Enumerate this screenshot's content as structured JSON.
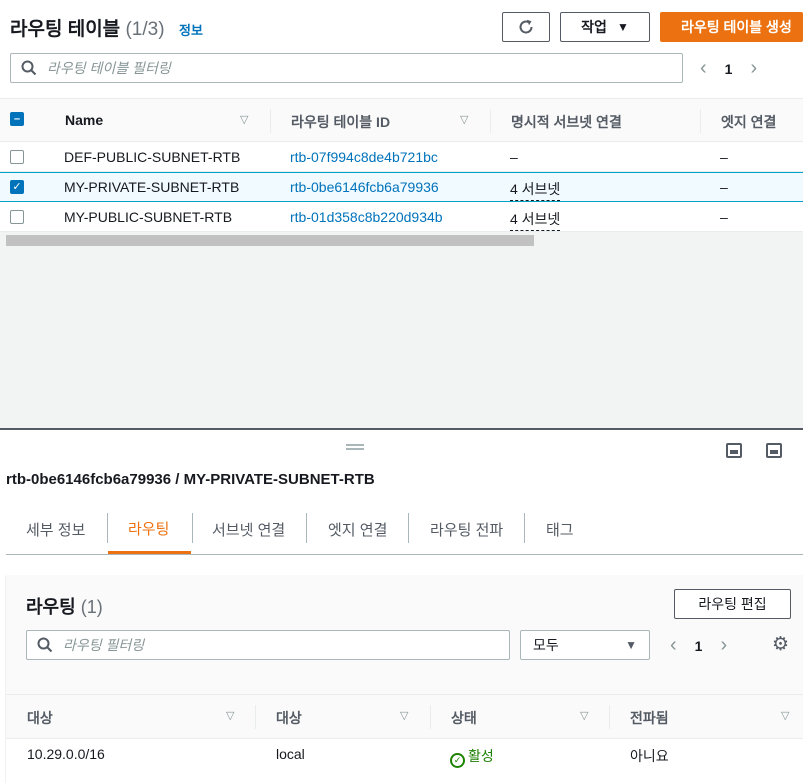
{
  "top_panel": {
    "title": "라우팅 테이블",
    "count": "(1/3)",
    "info_link": "정보",
    "actions_label": "작업",
    "create_label": "라우팅 테이블 생성",
    "search_placeholder": "라우팅 테이블 필터링",
    "page": "1",
    "columns": [
      "Name",
      "라우팅 테이블 ID",
      "명시적 서브넷 연결",
      "엣지 연결"
    ],
    "rows": [
      {
        "name": "DEF-PUBLIC-SUBNET-RTB",
        "id": "rtb-07f994c8de4b721bc",
        "subnets": "–",
        "edge": "–",
        "selected": false
      },
      {
        "name": "MY-PRIVATE-SUBNET-RTB",
        "id": "rtb-0be6146fcb6a79936",
        "subnets": "4 서브넷",
        "edge": "–",
        "selected": true
      },
      {
        "name": "MY-PUBLIC-SUBNET-RTB",
        "id": "rtb-01d358c8b220d934b",
        "subnets": "4 서브넷",
        "edge": "–",
        "selected": false
      }
    ]
  },
  "detail": {
    "title": "rtb-0be6146fcb6a79936 / MY-PRIVATE-SUBNET-RTB",
    "tabs": [
      "세부 정보",
      "라우팅",
      "서브넷 연결",
      "엣지 연결",
      "라우팅 전파",
      "태그"
    ],
    "active_tab": "라우팅",
    "routes": {
      "title": "라우팅",
      "count": "(1)",
      "edit_label": "라우팅 편집",
      "search_placeholder": "라우팅 필터링",
      "select_value": "모두",
      "page": "1",
      "columns": [
        "대상",
        "대상",
        "상태",
        "전파됨"
      ],
      "rows": [
        {
          "destination": "10.29.0.0/16",
          "target": "local",
          "status": "활성",
          "propagated": "아니요"
        }
      ]
    }
  },
  "colors": {
    "accent": "#ec7211",
    "link": "#0073bb",
    "success": "#1d8102"
  }
}
